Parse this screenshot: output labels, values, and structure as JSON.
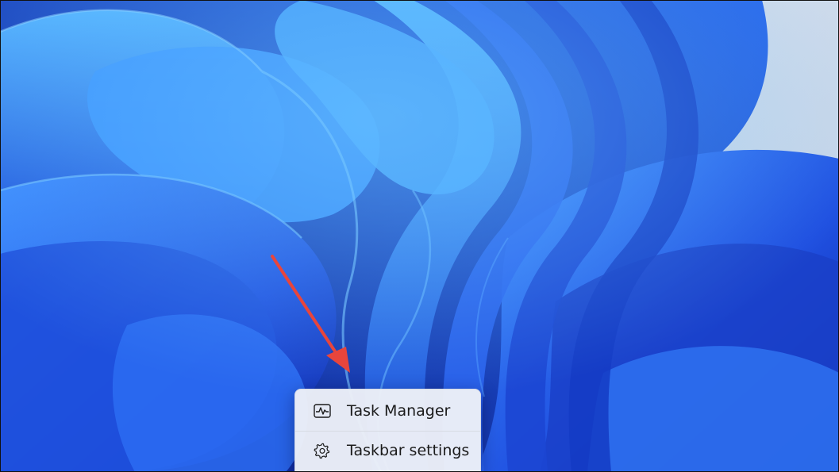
{
  "context_menu": {
    "items": [
      {
        "label": "Task Manager",
        "icon": "task-manager-icon"
      },
      {
        "label": "Taskbar settings",
        "icon": "gear-icon"
      }
    ]
  },
  "annotation": {
    "arrow_color": "#e8453c"
  },
  "colors": {
    "wallpaper_base": "#1c49d8",
    "wallpaper_highlight": "#3aa0ff",
    "wallpaper_background": "#c9d6e6",
    "menu_background": "#eceff7"
  }
}
